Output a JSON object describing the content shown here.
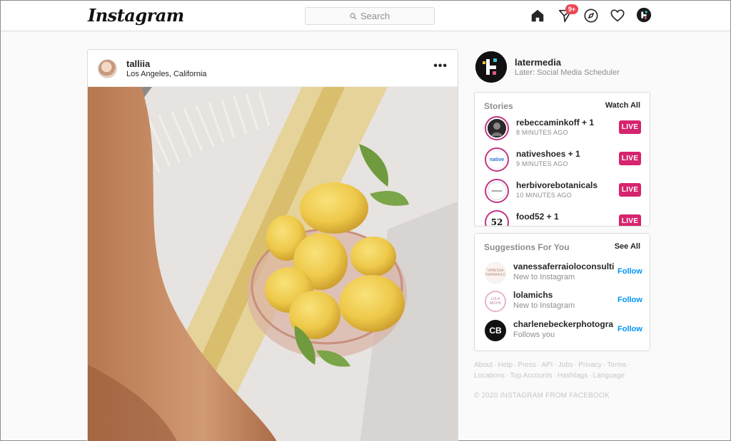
{
  "header": {
    "logo": "Instagram",
    "search_placeholder": "Search",
    "activity_badge": "9+"
  },
  "post": {
    "username": "talliia",
    "location": "Los Angeles, California",
    "more": "•••"
  },
  "profile": {
    "username": "latermedia",
    "fullname": "Later: Social Media Scheduler"
  },
  "stories": {
    "title": "Stories",
    "link": "Watch All",
    "items": [
      {
        "name": "rebeccaminkoff + 1",
        "time": "8 MINUTES AGO",
        "badge": "LIVE",
        "avatar_text": ""
      },
      {
        "name": "nativeshoes + 1",
        "time": "9 MINUTES AGO",
        "badge": "LIVE",
        "avatar_text": "native"
      },
      {
        "name": "herbivorebotanicals",
        "time": "10 MINUTES AGO",
        "badge": "LIVE",
        "avatar_text": ""
      },
      {
        "name": "food52 + 1",
        "time": "",
        "badge": "LIVE",
        "avatar_text": "52"
      }
    ]
  },
  "suggestions": {
    "title": "Suggestions For You",
    "link": "See All",
    "items": [
      {
        "name": "vanessaferraioloconsulti",
        "sub": "New to Instagram",
        "action": "Follow",
        "avatar_text": "VANESSA FERRAIOLO"
      },
      {
        "name": "lolamichs",
        "sub": "New to Instagram",
        "action": "Follow",
        "avatar_text": "LOLA MICHS"
      },
      {
        "name": "charlenebeckerphotogra",
        "sub": "Follows you",
        "action": "Follow",
        "avatar_text": "CB"
      }
    ]
  },
  "footer": {
    "links": [
      "About",
      "Help",
      "Press",
      "API",
      "Jobs",
      "Privacy",
      "Terms",
      "Locations",
      "Top Accounts",
      "Hashtags",
      "Language"
    ],
    "copyright": "© 2020 INSTAGRAM FROM FACEBOOK"
  },
  "colors": {
    "live": "#d6246e",
    "follow": "#0095f6",
    "badge": "#ed4956",
    "story_ring": "#c13584"
  },
  "icons": [
    "search-icon",
    "home-icon",
    "direct-icon",
    "explore-icon",
    "heart-icon",
    "more-icon"
  ]
}
